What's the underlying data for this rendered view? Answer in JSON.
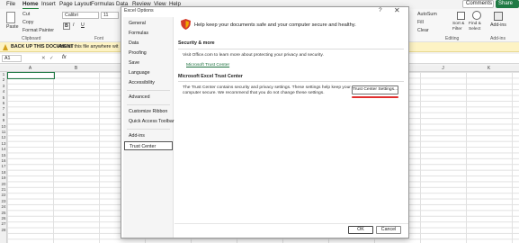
{
  "menubar": {
    "tabs": [
      "File",
      "Home",
      "Insert",
      "Page Layout",
      "Formulas",
      "Data",
      "Review",
      "View",
      "Help"
    ],
    "comments_label": "Comments",
    "share_label": "Share"
  },
  "ribbon": {
    "paste_label": "Paste",
    "cut_label": "Cut",
    "copy_label": "Copy",
    "format_painter_label": "Format Painter",
    "clipboard_group": "Clipboard",
    "font_name": "Calibri",
    "font_size": "11",
    "font_group": "Font",
    "autosum_label": "AutoSum",
    "fill_label": "Fill",
    "clear_label": "Clear",
    "sort_filter_label": "Sort & Filter",
    "find_select_label": "Find & Select",
    "editing_group": "Editing",
    "addins_label": "Add-ins",
    "addins_group": "Add-ins"
  },
  "backup_bar": {
    "title": "BACK UP THIS DOCUMENT",
    "message": "Access this file anywhere wit"
  },
  "formula_bar": {
    "name_box": "A1",
    "fx": "fx"
  },
  "sheet": {
    "columns": [
      "A",
      "B",
      "C",
      "D",
      "E",
      "F",
      "G",
      "H",
      "I",
      "J",
      "K",
      "L"
    ],
    "rows": [
      "1",
      "2",
      "3",
      "4",
      "5",
      "6",
      "7",
      "8",
      "9",
      "10",
      "11",
      "12",
      "13",
      "14",
      "15",
      "16",
      "17",
      "18",
      "19",
      "20",
      "21",
      "22",
      "23",
      "24",
      "25",
      "26",
      "27",
      "28"
    ]
  },
  "dialog": {
    "title": "Excel Options",
    "help": "?",
    "close": "✕",
    "sidebar": [
      "General",
      "Formulas",
      "Data",
      "Proofing",
      "Save",
      "Language",
      "Accessibility",
      "Advanced",
      "Customize Ribbon",
      "Quick Access Toolbar",
      "Add-ins",
      "Trust Center"
    ],
    "intro": "Help keep your documents safe and your computer secure and healthy.",
    "security_heading": "Security & more",
    "security_text": "Visit Office.com to learn more about protecting your privacy and security.",
    "ms_trust_link": "Microsoft Trust Center",
    "trust_heading": "Microsoft Excel Trust Center",
    "trust_text_1": "The Trust Center contains security and privacy settings. These settings help keep your",
    "trust_text_2": "computer secure. We recommend that you do not change these settings.",
    "trust_settings_button": "Trust Center Settings...",
    "ok": "OK",
    "cancel": "Cancel"
  },
  "colors": {
    "accent_green": "#1f7a44",
    "warning_bar": "#fdf3c4",
    "highlight_red": "#e0302f",
    "shield_red": "#d43b2a",
    "shield_orange": "#f2a900"
  }
}
